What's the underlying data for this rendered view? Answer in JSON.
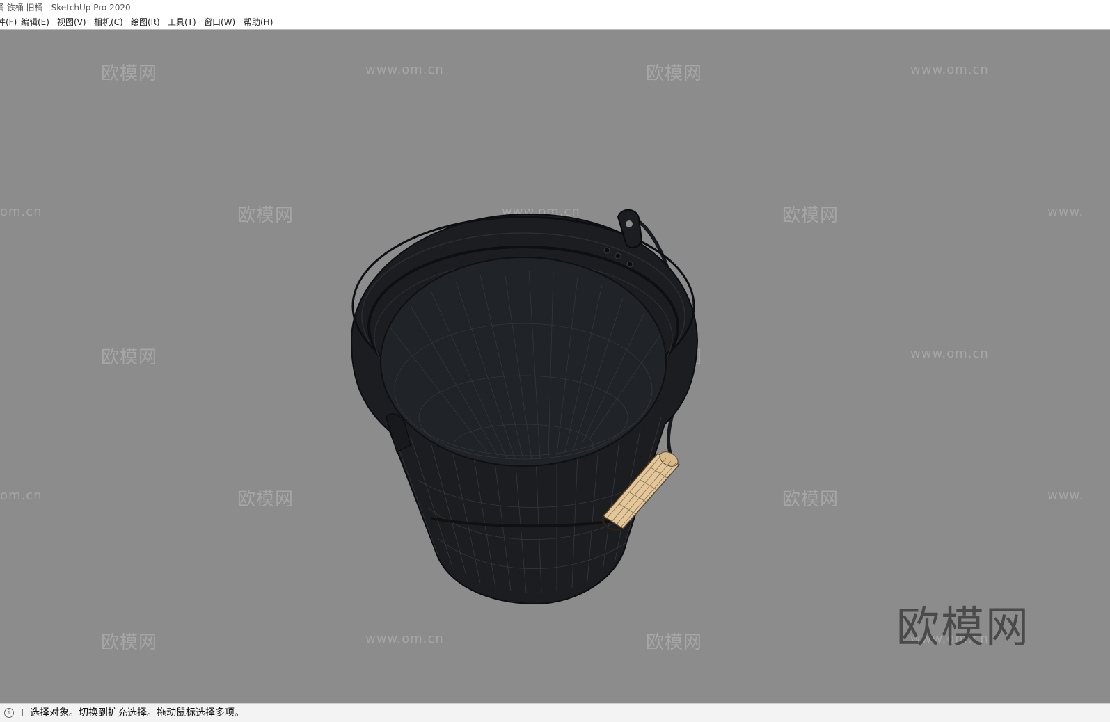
{
  "window": {
    "title": "桶 铁桶 旧桶 - SketchUp Pro 2020"
  },
  "menu": {
    "items": [
      {
        "label": "件(F)"
      },
      {
        "label": "编辑(E)"
      },
      {
        "label": "视图(V)"
      },
      {
        "label": "相机(C)"
      },
      {
        "label": "绘图(R)"
      },
      {
        "label": "工具(T)"
      },
      {
        "label": "窗口(W)"
      },
      {
        "label": "帮助(H)"
      }
    ]
  },
  "watermarks": {
    "brand": "欧模网",
    "url": "www.om.cn",
    "url_cut": "om.cn",
    "url_right": "www.",
    "big": "欧模网"
  },
  "status": {
    "icon": "info-icon",
    "text": "选择对象。切换到扩充选择。拖动鼠标选择多项。"
  },
  "colors": {
    "viewport_bg": "#8c8c8c",
    "bucket": "#1b1d21",
    "handle_grip": "#e3c79a"
  }
}
